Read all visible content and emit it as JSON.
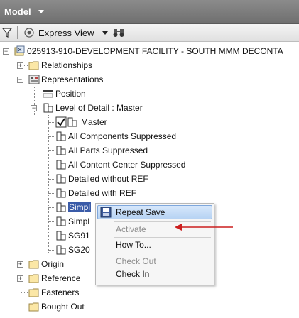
{
  "header": {
    "title": "Model"
  },
  "toolbar": {
    "express_view_label": "Express View"
  },
  "tree": {
    "root": "025913-910-DEVELOPMENT FACILITY - SOUTH MMM DECONTA",
    "relationships": "Relationships",
    "representations": "Representations",
    "position": "Position",
    "lod": "Level of Detail : Master",
    "master": "Master",
    "all_components": "All Components Suppressed",
    "all_parts": "All Parts Suppressed",
    "all_content": "All Content Center Suppressed",
    "detailed_without": "Detailed without REF",
    "detailed_with": "Detailed with REF",
    "simpl1": "Simpl",
    "simpl2": "Simpl",
    "sg91": "SG91",
    "sg20": "SG20",
    "origin": "Origin",
    "reference": "Reference",
    "fasteners": "Fasteners",
    "bought_out": "Bought Out"
  },
  "context_menu": {
    "repeat_save": "Repeat Save",
    "activate": "Activate",
    "how_to": "How To...",
    "check_out": "Check Out",
    "check_in": "Check In"
  },
  "colors": {
    "selection": "#3a5ba8",
    "annotation_arrow": "#cc1f1f",
    "header": "#7a7a7a"
  }
}
